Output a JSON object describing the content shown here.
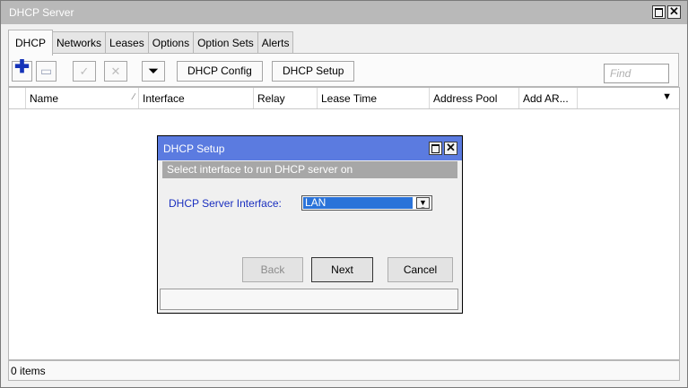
{
  "window": {
    "title": "DHCP Server",
    "tabs": [
      {
        "label": "DHCP",
        "active": true
      },
      {
        "label": "Networks"
      },
      {
        "label": "Leases"
      },
      {
        "label": "Options"
      },
      {
        "label": "Option Sets"
      },
      {
        "label": "Alerts"
      }
    ],
    "toolbar": {
      "add_icon": "plus-icon",
      "remove_icon": "minus-icon",
      "enable_icon": "check-icon",
      "disable_icon": "cross-icon",
      "filter_icon": "filter-icon",
      "dhcp_config_label": "DHCP Config",
      "dhcp_setup_label": "DHCP Setup",
      "find_placeholder": "Find"
    },
    "columns": [
      "Name",
      "Interface",
      "Relay",
      "Lease Time",
      "Address Pool",
      "Add AR..."
    ],
    "status_text": "0 items"
  },
  "dialog": {
    "title": "DHCP Setup",
    "subtitle": "Select interface to run DHCP server on",
    "field_label": "DHCP Server Interface:",
    "field_value": "LAN",
    "buttons": {
      "back": "Back",
      "next": "Next",
      "cancel": "Cancel"
    }
  },
  "colors": {
    "window_title_bg": "#b9b9b9",
    "dialog_title_bg": "#5b7be0",
    "accent_blue": "#1a2fbf",
    "selection": "#2a73d9"
  }
}
